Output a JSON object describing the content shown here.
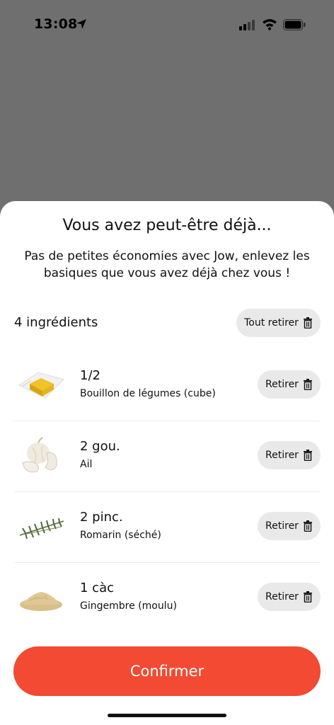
{
  "status": {
    "time": "13:08"
  },
  "sheet": {
    "title": "Vous avez peut-être déjà...",
    "subtitle": "Pas de petites économies avec Jow, enlevez les basiques que vous avez déjà chez vous !",
    "count_label": "4 ingrédients",
    "remove_all_label": "Tout retirer",
    "remove_label": "Retirer",
    "confirm_label": "Confirmer"
  },
  "ingredients": [
    {
      "qty": "1/2",
      "name": "Bouillon de légumes (cube)",
      "icon": "bouillon-cube-image"
    },
    {
      "qty": "2 gou.",
      "name": "Ail",
      "icon": "garlic-image"
    },
    {
      "qty": "2 pinc.",
      "name": "Romarin (séché)",
      "icon": "rosemary-image"
    },
    {
      "qty": "1 càc",
      "name": "Gingembre (moulu)",
      "icon": "ginger-powder-image"
    }
  ],
  "colors": {
    "accent": "#f24a33",
    "pill_bg": "#e9e9e9",
    "overlay": "#6f6f6f"
  }
}
